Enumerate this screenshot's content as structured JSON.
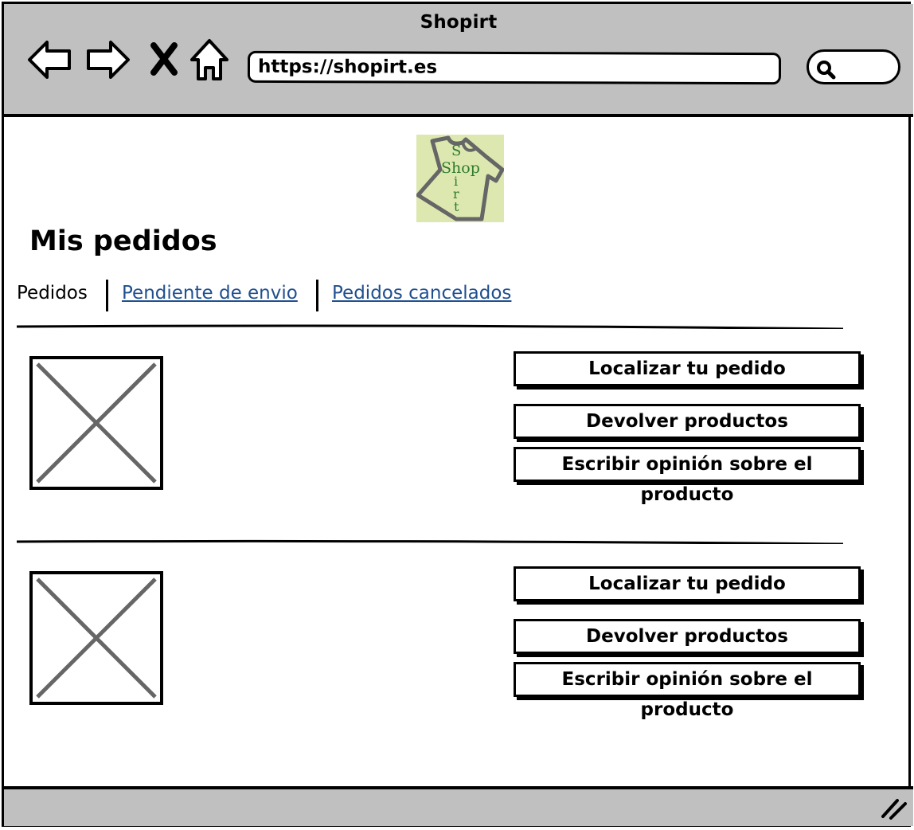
{
  "window": {
    "title": "Shopirt"
  },
  "browser": {
    "url": "https://shopirt.es",
    "icons": [
      "back-arrow-icon",
      "forward-arrow-icon",
      "close-x-icon",
      "home-icon",
      "search-icon"
    ]
  },
  "logo": {
    "text_shop": "Shop",
    "text_shirt": "S",
    "text_irt": "irt"
  },
  "page": {
    "title": "Mis pedidos",
    "tabs": [
      {
        "label": "Pedidos"
      },
      {
        "label": "Pendiente de envio"
      },
      {
        "label": "Pedidos cancelados"
      }
    ]
  },
  "orders": [
    {
      "image": "placeholder-image-icon",
      "buttons": [
        "Localizar tu pedido",
        "Devolver productos",
        "Escribir opinión sobre el producto"
      ]
    },
    {
      "image": "placeholder-image-icon",
      "buttons": [
        "Localizar tu pedido",
        "Devolver productos",
        "Escribir opinión sobre el producto"
      ]
    }
  ],
  "colors": {
    "chrome": "#c0c0c0",
    "link": "#1f4f8f",
    "logo_bg": "#dde8b0",
    "logo_text": "#2f7a2f"
  }
}
